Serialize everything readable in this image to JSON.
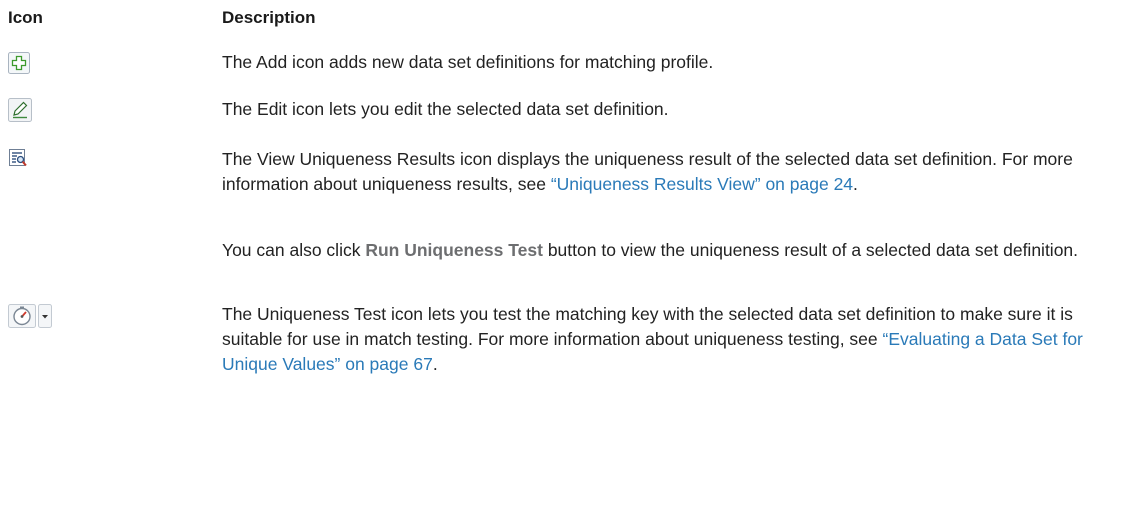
{
  "table": {
    "header_icon": "Icon",
    "header_description": "Description"
  },
  "rows": {
    "add": {
      "icon": "add-plus-icon",
      "text": "The Add icon adds new data set definitions for matching profile."
    },
    "edit": {
      "icon": "pencil-edit-icon",
      "text": "The Edit icon lets you edit the selected data set definition."
    },
    "view": {
      "icon": "view-uniqueness-results-icon",
      "text_a": "The View Uniqueness Results icon displays the uniqueness result of the selected data set definition. For more information about uniqueness results, see ",
      "link": "“Uniqueness Results View” on page 24",
      "text_b": ".",
      "text2_a": "You can also click ",
      "text2_strong": "Run Uniqueness Test",
      "text2_b": " button to view the uniqueness result of a selected data set definition."
    },
    "test": {
      "icon": "uniqueness-test-gauge-icon",
      "dropdown_icon": "dropdown-arrow-icon",
      "text_a": "The Uniqueness Test icon lets you test the matching key with the selected data set definition to make sure it is suitable for use in match testing. For more information about uniqueness testing, see ",
      "link": "“Evaluating a Data Set for Unique Values” on page 67",
      "text_b": "."
    }
  },
  "colors": {
    "link": "#2a7ab8",
    "ui_strong": "#6d6e70",
    "add_icon_green": "#3d9a2c"
  }
}
